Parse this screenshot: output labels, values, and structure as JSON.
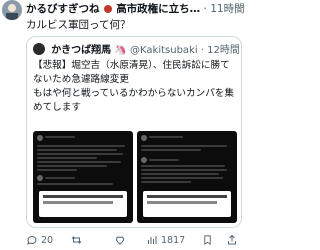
{
  "tweet": {
    "author_name": "かるびすぎつね",
    "author_suffix": "高市政権に立ち…",
    "time": "11時間",
    "text": "カルビス軍団って何？",
    "more_icon": "more-icon"
  },
  "quote": {
    "name": "かきつば翔馬",
    "handle": "@Kakitsubaki",
    "time": "12時間",
    "lines": [
      "【悲報】堀空吉（水原清晃）、住民訴訟に勝て",
      "ないため急遽路線変更",
      "もはや何と戦っているかわからないカンパを集",
      "めてします"
    ]
  },
  "actions": {
    "reply": "20",
    "retweet": "",
    "like": "",
    "views": "1817",
    "icons": [
      "reply-icon",
      "retweet-icon",
      "like-icon",
      "views-icon",
      "bookmark-icon",
      "share-icon"
    ]
  },
  "colors": {
    "text": "#0f1419",
    "muted": "#536471",
    "border": "#cfd9de",
    "shot_bg": "#0c0c0c"
  }
}
